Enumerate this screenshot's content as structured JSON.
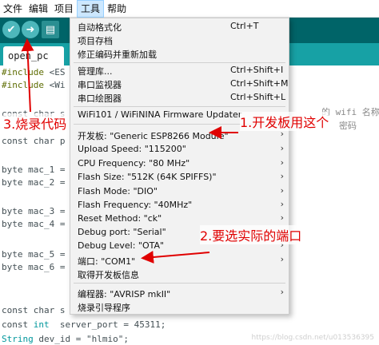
{
  "menubar": {
    "items": [
      "文件",
      "编辑",
      "项目",
      "工具",
      "帮助"
    ]
  },
  "toolbar": {
    "verify_icon": "check-icon",
    "upload_icon": "right-arrow-icon",
    "new_icon": "new-file-icon"
  },
  "tab": {
    "label": "open_pc"
  },
  "code": {
    "line_include1": [
      "#include ",
      "<ES"
    ],
    "line_include2": [
      "#include ",
      "<Wi"
    ],
    "line_const1": "const char s",
    "line_const2": "const char p",
    "line_wifi_comment": "的 wifi 名称",
    "line_wifi_comment2": "密码",
    "mac1": "byte mac_1 =",
    "mac2": "byte mac_2 =",
    "mac3": "byte mac_3 =",
    "mac4": "byte mac_4 =",
    "mac5": "byte mac_5 =",
    "mac6": "byte mac_6 =",
    "const_char_last": "const char s",
    "server_port": [
      "const ",
      "int",
      "  server_port = 45311;"
    ],
    "dev_id": [
      "String",
      " dev_id = \"hlmio\";"
    ]
  },
  "menu": {
    "items": [
      {
        "label": "自动格式化",
        "shortcut": "Ctrl+T"
      },
      {
        "label": "项目存档",
        "shortcut": ""
      },
      {
        "label": "修正编码并重新加载",
        "shortcut": ""
      },
      {
        "label": "管理库...",
        "shortcut": "Ctrl+Shift+I"
      },
      {
        "label": "串口监视器",
        "shortcut": "Ctrl+Shift+M"
      },
      {
        "label": "串口绘图器",
        "shortcut": "Ctrl+Shift+L"
      },
      {
        "label": "WiFi101 / WiFiNINA Firmware Updater",
        "shortcut": ""
      },
      {
        "label": "开发板: \"Generic ESP8266 Module\"",
        "arrow": "›"
      },
      {
        "label": "Upload Speed: \"115200\"",
        "arrow": "›"
      },
      {
        "label": "CPU Frequency: \"80 MHz\"",
        "arrow": "›"
      },
      {
        "label": "Flash Size: \"512K (64K SPIFFS)\"",
        "arrow": "›"
      },
      {
        "label": "Flash Mode: \"DIO\"",
        "arrow": "›"
      },
      {
        "label": "Flash Frequency: \"40MHz\"",
        "arrow": "›"
      },
      {
        "label": "Reset Method: \"ck\"",
        "arrow": "›"
      },
      {
        "label": "Debug port: \"Serial\"",
        "arrow": "›"
      },
      {
        "label": "Debug Level: \"OTA\"",
        "arrow": "›"
      },
      {
        "label": "端口: \"COM1\"",
        "arrow": "›"
      },
      {
        "label": "取得开发板信息",
        "arrow": ""
      },
      {
        "label": "编程器: \"AVRISP mkII\"",
        "arrow": "›"
      },
      {
        "label": "烧录引导程序",
        "arrow": ""
      }
    ]
  },
  "annotations": {
    "a1": "1.开发板用这个",
    "a2": "2.要选实际的端口",
    "a3": "3.烧录代码"
  },
  "watermark": "https://blog.csdn.net/u013536395",
  "colors": {
    "annotation": "#e00000",
    "toolbar": "#006468",
    "tabstrip": "#17a1a5"
  }
}
